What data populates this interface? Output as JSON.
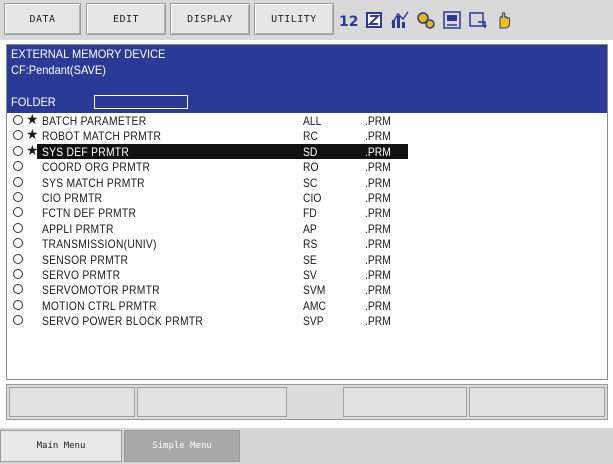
{
  "menubar": {
    "buttons": [
      "DATA",
      "EDIT",
      "DISPLAY",
      "UTILITY"
    ],
    "icons": [
      "language-toggle-icon",
      "edit-mode-icon",
      "chart-icon",
      "gear-icon",
      "io-icon",
      "window-icon",
      "hand-icon"
    ]
  },
  "header": {
    "title": "EXTERNAL MEMORY DEVICE",
    "device": "CF:Pendant(SAVE)",
    "folder_label": "FOLDER",
    "folder_value": ""
  },
  "rows": [
    {
      "name": "BATCH PARAMETER",
      "code": "ALL",
      "ext": ".PRM",
      "star": "★"
    },
    {
      "name": "ROBOT MATCH PRMTR",
      "code": "RC",
      "ext": ".PRM",
      "star": "★"
    },
    {
      "name": "SYS DEF PRMTR",
      "code": "SD",
      "ext": ".PRM",
      "star": "★"
    },
    {
      "name": "COORD ORG PRMTR",
      "code": "RO",
      "ext": ".PRM",
      "star": ""
    },
    {
      "name": "SYS MATCH PRMTR",
      "code": "SC",
      "ext": ".PRM",
      "star": ""
    },
    {
      "name": "CIO PRMTR",
      "code": "CIO",
      "ext": ".PRM",
      "star": ""
    },
    {
      "name": "FCTN DEF PRMTR",
      "code": "FD",
      "ext": ".PRM",
      "star": ""
    },
    {
      "name": "APPLI PRMTR",
      "code": "AP",
      "ext": ".PRM",
      "star": ""
    },
    {
      "name": "TRANSMISSION(UNIV)",
      "code": "RS",
      "ext": ".PRM",
      "star": ""
    },
    {
      "name": "SENSOR PRMTR",
      "code": "SE",
      "ext": ".PRM",
      "star": ""
    },
    {
      "name": "SERVO PRMTR",
      "code": "SV",
      "ext": ".PRM",
      "star": ""
    },
    {
      "name": "SERVOMOTOR PRMTR",
      "code": "SVM",
      "ext": ".PRM",
      "star": ""
    },
    {
      "name": "MOTION CTRL PRMTR",
      "code": "AMC",
      "ext": ".PRM",
      "star": ""
    },
    {
      "name": "SERVO POWER BLOCK PRMTR",
      "code": "SVP",
      "ext": ".PRM",
      "star": ""
    }
  ],
  "selected_row": "SYS DEF PRMTR",
  "bottombar": {
    "main_menu": "Main Menu",
    "simple_menu": "Simple Menu"
  },
  "colors": {
    "header_bg": "#2b3a96",
    "selected_bg": "#111111"
  }
}
